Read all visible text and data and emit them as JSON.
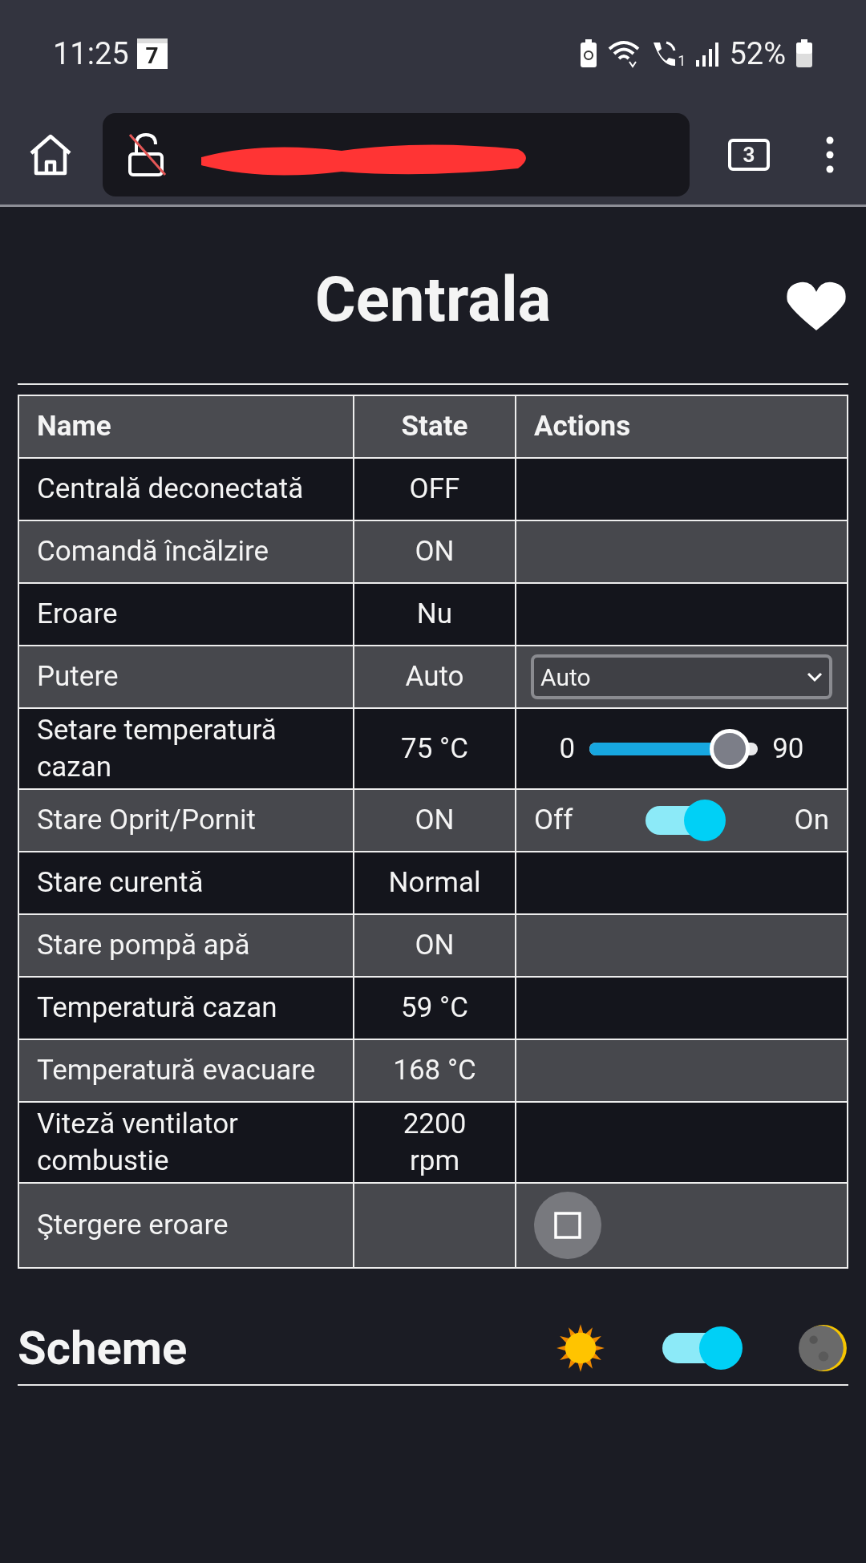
{
  "status_bar": {
    "time": "11:25",
    "calendar_day": "7",
    "sim_slot": "1",
    "battery": "52%"
  },
  "browser": {
    "tab_count": "3"
  },
  "page": {
    "title": "Centrala"
  },
  "table": {
    "columns": [
      "Name",
      "State",
      "Actions"
    ],
    "rows": [
      {
        "name": "Centrală deconectată",
        "state": "OFF",
        "kind": "none"
      },
      {
        "name": "Comandă încălzire",
        "state": "ON",
        "kind": "none"
      },
      {
        "name": "Eroare",
        "state": "Nu",
        "kind": "none"
      },
      {
        "name": "Putere",
        "state": "Auto",
        "kind": "select",
        "value": "Auto"
      },
      {
        "name": "Setare temperatură cazan",
        "state": "75 °C",
        "kind": "slider",
        "min": "0",
        "max": "90",
        "level": 0.833
      },
      {
        "name": "Stare Oprit/Pornit",
        "state": "ON",
        "kind": "switch",
        "off_label": "Off",
        "on_label": "On",
        "on": true
      },
      {
        "name": "Stare curentă",
        "state": "Normal",
        "kind": "none"
      },
      {
        "name": "Stare pompă apă",
        "state": "ON",
        "kind": "none"
      },
      {
        "name": "Temperatură cazan",
        "state": "59 °C",
        "kind": "none"
      },
      {
        "name": "Temperatură evacuare",
        "state": "168 °C",
        "kind": "none"
      },
      {
        "name": "Viteză ventilator combustie",
        "state": "2200 rpm",
        "kind": "none"
      },
      {
        "name": "Ştergere eroare",
        "state": "",
        "kind": "button"
      }
    ]
  },
  "scheme": {
    "title": "Scheme",
    "dark": true
  }
}
